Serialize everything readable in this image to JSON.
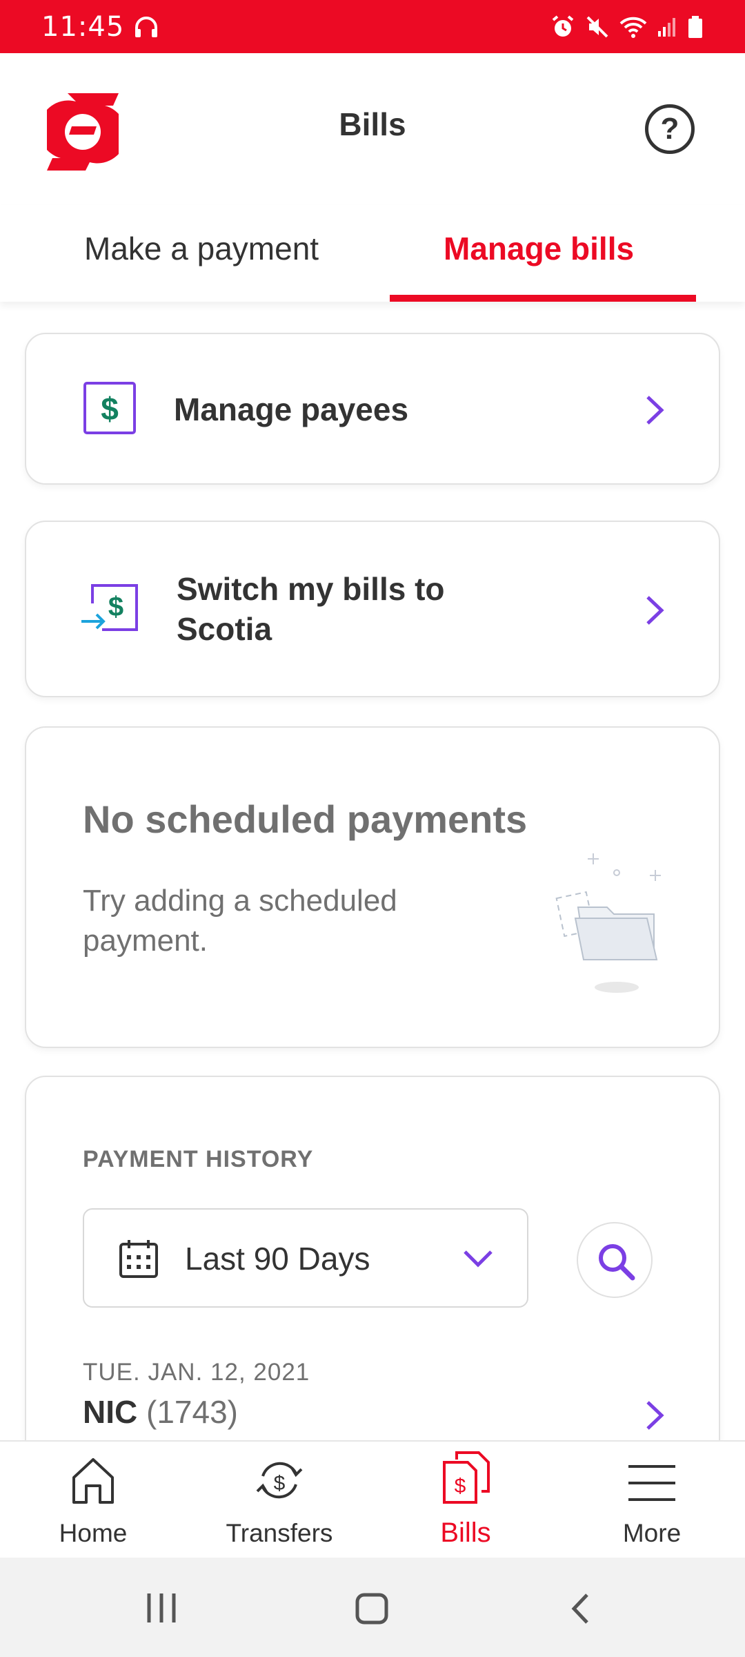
{
  "status_bar": {
    "time": "11:45"
  },
  "header": {
    "title": "Bills",
    "help_label": "?"
  },
  "tabs": [
    {
      "label": "Make a payment",
      "active": false
    },
    {
      "label": "Manage bills",
      "active": true
    }
  ],
  "cards": {
    "manage_payees": {
      "label": "Manage payees"
    },
    "switch_bills": {
      "line1": "Switch my bills to",
      "line2": "Scotia"
    }
  },
  "empty_state": {
    "title": "No scheduled payments",
    "subtitle": "Try adding a scheduled payment."
  },
  "payment_history": {
    "title": "PAYMENT HISTORY",
    "date_filter": "Last 90 Days",
    "transactions": [
      {
        "date": "TUE. JAN. 12, 2021",
        "payee": "NIC",
        "account": "(1743)"
      }
    ]
  },
  "bottom_nav": [
    {
      "label": "Home",
      "icon": "home-icon",
      "active": false
    },
    {
      "label": "Transfers",
      "icon": "transfers-icon",
      "active": false
    },
    {
      "label": "Bills",
      "icon": "bills-icon",
      "active": true
    },
    {
      "label": "More",
      "icon": "menu-icon",
      "active": false
    }
  ],
  "colors": {
    "brand_red": "#ec0a24",
    "accent_purple": "#7b3fe4",
    "dollar_green": "#138160",
    "arrow_blue": "#1ca3dc"
  }
}
